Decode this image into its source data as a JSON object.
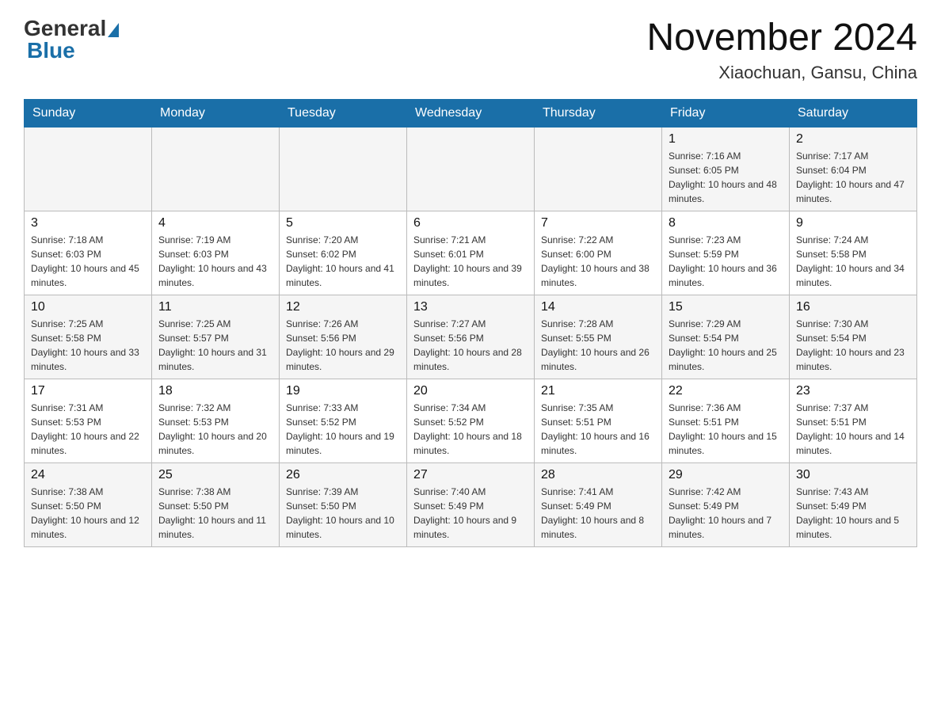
{
  "logo": {
    "general": "General",
    "blue": "Blue"
  },
  "header": {
    "month": "November 2024",
    "location": "Xiaochuan, Gansu, China"
  },
  "weekdays": [
    "Sunday",
    "Monday",
    "Tuesday",
    "Wednesday",
    "Thursday",
    "Friday",
    "Saturday"
  ],
  "weeks": [
    [
      {
        "day": "",
        "info": ""
      },
      {
        "day": "",
        "info": ""
      },
      {
        "day": "",
        "info": ""
      },
      {
        "day": "",
        "info": ""
      },
      {
        "day": "",
        "info": ""
      },
      {
        "day": "1",
        "info": "Sunrise: 7:16 AM\nSunset: 6:05 PM\nDaylight: 10 hours and 48 minutes."
      },
      {
        "day": "2",
        "info": "Sunrise: 7:17 AM\nSunset: 6:04 PM\nDaylight: 10 hours and 47 minutes."
      }
    ],
    [
      {
        "day": "3",
        "info": "Sunrise: 7:18 AM\nSunset: 6:03 PM\nDaylight: 10 hours and 45 minutes."
      },
      {
        "day": "4",
        "info": "Sunrise: 7:19 AM\nSunset: 6:03 PM\nDaylight: 10 hours and 43 minutes."
      },
      {
        "day": "5",
        "info": "Sunrise: 7:20 AM\nSunset: 6:02 PM\nDaylight: 10 hours and 41 minutes."
      },
      {
        "day": "6",
        "info": "Sunrise: 7:21 AM\nSunset: 6:01 PM\nDaylight: 10 hours and 39 minutes."
      },
      {
        "day": "7",
        "info": "Sunrise: 7:22 AM\nSunset: 6:00 PM\nDaylight: 10 hours and 38 minutes."
      },
      {
        "day": "8",
        "info": "Sunrise: 7:23 AM\nSunset: 5:59 PM\nDaylight: 10 hours and 36 minutes."
      },
      {
        "day": "9",
        "info": "Sunrise: 7:24 AM\nSunset: 5:58 PM\nDaylight: 10 hours and 34 minutes."
      }
    ],
    [
      {
        "day": "10",
        "info": "Sunrise: 7:25 AM\nSunset: 5:58 PM\nDaylight: 10 hours and 33 minutes."
      },
      {
        "day": "11",
        "info": "Sunrise: 7:25 AM\nSunset: 5:57 PM\nDaylight: 10 hours and 31 minutes."
      },
      {
        "day": "12",
        "info": "Sunrise: 7:26 AM\nSunset: 5:56 PM\nDaylight: 10 hours and 29 minutes."
      },
      {
        "day": "13",
        "info": "Sunrise: 7:27 AM\nSunset: 5:56 PM\nDaylight: 10 hours and 28 minutes."
      },
      {
        "day": "14",
        "info": "Sunrise: 7:28 AM\nSunset: 5:55 PM\nDaylight: 10 hours and 26 minutes."
      },
      {
        "day": "15",
        "info": "Sunrise: 7:29 AM\nSunset: 5:54 PM\nDaylight: 10 hours and 25 minutes."
      },
      {
        "day": "16",
        "info": "Sunrise: 7:30 AM\nSunset: 5:54 PM\nDaylight: 10 hours and 23 minutes."
      }
    ],
    [
      {
        "day": "17",
        "info": "Sunrise: 7:31 AM\nSunset: 5:53 PM\nDaylight: 10 hours and 22 minutes."
      },
      {
        "day": "18",
        "info": "Sunrise: 7:32 AM\nSunset: 5:53 PM\nDaylight: 10 hours and 20 minutes."
      },
      {
        "day": "19",
        "info": "Sunrise: 7:33 AM\nSunset: 5:52 PM\nDaylight: 10 hours and 19 minutes."
      },
      {
        "day": "20",
        "info": "Sunrise: 7:34 AM\nSunset: 5:52 PM\nDaylight: 10 hours and 18 minutes."
      },
      {
        "day": "21",
        "info": "Sunrise: 7:35 AM\nSunset: 5:51 PM\nDaylight: 10 hours and 16 minutes."
      },
      {
        "day": "22",
        "info": "Sunrise: 7:36 AM\nSunset: 5:51 PM\nDaylight: 10 hours and 15 minutes."
      },
      {
        "day": "23",
        "info": "Sunrise: 7:37 AM\nSunset: 5:51 PM\nDaylight: 10 hours and 14 minutes."
      }
    ],
    [
      {
        "day": "24",
        "info": "Sunrise: 7:38 AM\nSunset: 5:50 PM\nDaylight: 10 hours and 12 minutes."
      },
      {
        "day": "25",
        "info": "Sunrise: 7:38 AM\nSunset: 5:50 PM\nDaylight: 10 hours and 11 minutes."
      },
      {
        "day": "26",
        "info": "Sunrise: 7:39 AM\nSunset: 5:50 PM\nDaylight: 10 hours and 10 minutes."
      },
      {
        "day": "27",
        "info": "Sunrise: 7:40 AM\nSunset: 5:49 PM\nDaylight: 10 hours and 9 minutes."
      },
      {
        "day": "28",
        "info": "Sunrise: 7:41 AM\nSunset: 5:49 PM\nDaylight: 10 hours and 8 minutes."
      },
      {
        "day": "29",
        "info": "Sunrise: 7:42 AM\nSunset: 5:49 PM\nDaylight: 10 hours and 7 minutes."
      },
      {
        "day": "30",
        "info": "Sunrise: 7:43 AM\nSunset: 5:49 PM\nDaylight: 10 hours and 5 minutes."
      }
    ]
  ]
}
